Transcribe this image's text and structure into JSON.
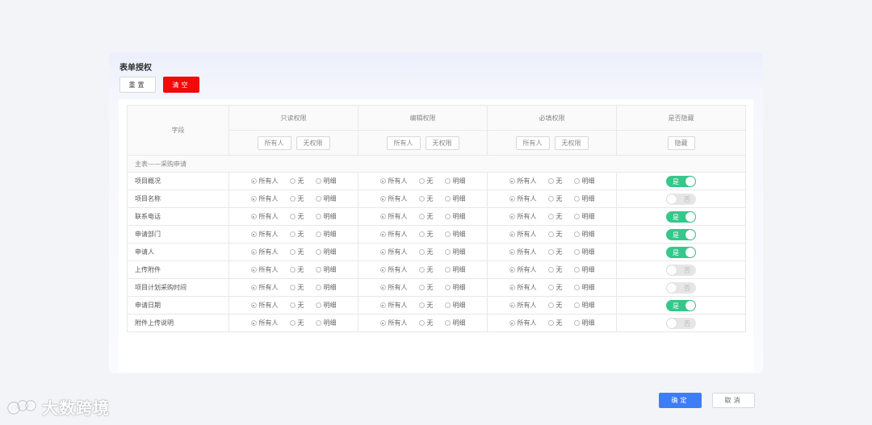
{
  "panel": {
    "title": "表单授权",
    "reset_label": "重置",
    "clear_label": "清空"
  },
  "table": {
    "col_field": "字段",
    "groups": [
      {
        "title": "只读权限",
        "chips": [
          "所有人",
          "无权限"
        ]
      },
      {
        "title": "编辑权限",
        "chips": [
          "所有人",
          "无权限"
        ]
      },
      {
        "title": "必填权限",
        "chips": [
          "所有人",
          "无权限"
        ]
      },
      {
        "title": "是否隐藏",
        "chips": [
          "隐藏"
        ]
      }
    ],
    "section": "主表——采购申请",
    "radio_options": [
      "所有人",
      "无",
      "明细"
    ],
    "rows": [
      {
        "field": "项目概况",
        "hidden": true
      },
      {
        "field": "项目名称",
        "hidden": false
      },
      {
        "field": "联系电话",
        "hidden": true
      },
      {
        "field": "申请部门",
        "hidden": true
      },
      {
        "field": "申请人",
        "hidden": true
      },
      {
        "field": "上传附件",
        "hidden": false
      },
      {
        "field": "项目计划采购时间",
        "hidden": false
      },
      {
        "field": "申请日期",
        "hidden": true
      },
      {
        "field": "附件上传说明",
        "hidden": false
      }
    ],
    "toggle_on": "是",
    "toggle_off": "否"
  },
  "footer": {
    "ok_label": "确定",
    "cancel_label": "取消"
  },
  "watermark": {
    "text": "大数跨境"
  },
  "colors": {
    "accent": "#3d7ef5",
    "danger": "#f10a0a",
    "toggle_on": "#34c88a",
    "toggle_off": "#e6e6e6"
  }
}
